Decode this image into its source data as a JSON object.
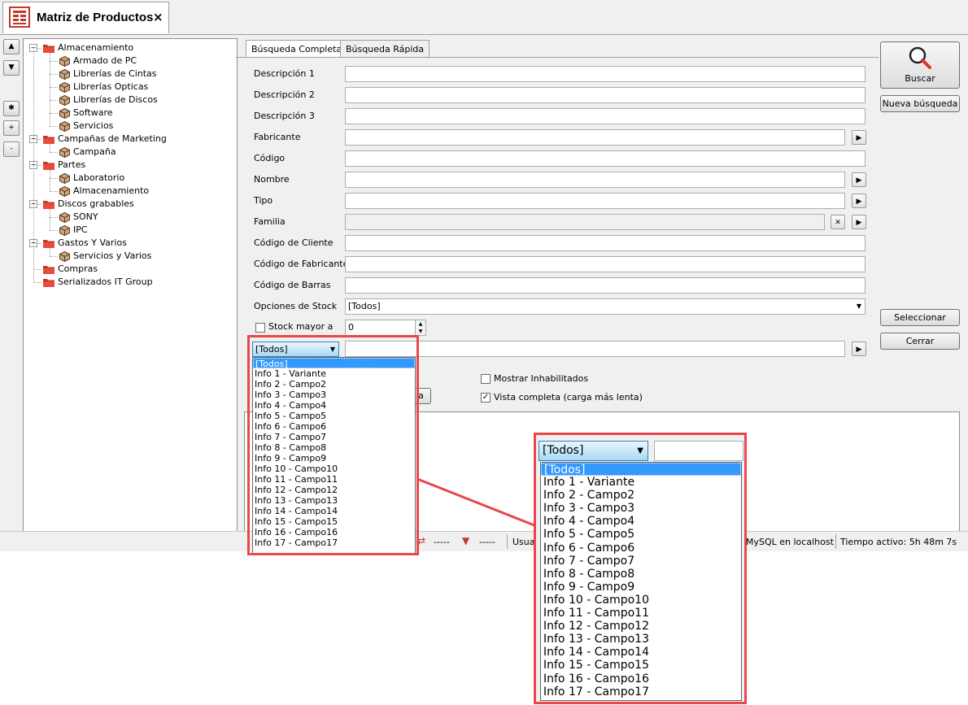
{
  "window": {
    "tab_title": "Matriz de Productos",
    "close_glyph": "×"
  },
  "sidebar_buttons": [
    "▲",
    "▼",
    "✱",
    "+",
    "-"
  ],
  "tree": [
    {
      "label": "Almacenamiento",
      "level": 0,
      "expanded": true
    },
    {
      "label": "Armado de PC",
      "level": 1
    },
    {
      "label": "Librerías de Cintas",
      "level": 1
    },
    {
      "label": "Librerías Opticas",
      "level": 1
    },
    {
      "label": "Librerías de Discos",
      "level": 1
    },
    {
      "label": "Software",
      "level": 1
    },
    {
      "label": "Servicios",
      "level": 1
    },
    {
      "label": "Campañas de Marketing",
      "level": 0,
      "expanded": true
    },
    {
      "label": "Campaña",
      "level": 1
    },
    {
      "label": "Partes",
      "level": 0,
      "expanded": true
    },
    {
      "label": "Laboratorio",
      "level": 1
    },
    {
      "label": "Almacenamiento",
      "level": 1
    },
    {
      "label": "Discos grabables",
      "level": 0,
      "expanded": true
    },
    {
      "label": "SONY",
      "level": 1
    },
    {
      "label": "IPC",
      "level": 1
    },
    {
      "label": "Gastos Y Varios",
      "level": 0,
      "expanded": true
    },
    {
      "label": "Servicios y Varios",
      "level": 1
    },
    {
      "label": "Compras",
      "level": 0
    },
    {
      "label": "Serializados IT Group",
      "level": 0
    }
  ],
  "search_tabs": [
    "Búsqueda Completa",
    "Búsqueda Rápida"
  ],
  "form": {
    "descripcion1": "Descripción 1",
    "descripcion2": "Descripción 2",
    "descripcion3": "Descripción 3",
    "fabricante": "Fabricante",
    "codigo": "Código",
    "nombre": "Nombre",
    "tipo": "Tipo",
    "familia": "Familia",
    "codigo_cliente": "Código de Cliente",
    "codigo_fabricante": "Código de Fabricante",
    "codigo_barras": "Código de Barras",
    "opciones_stock": "Opciones de Stock",
    "opciones_stock_value": "[Todos]",
    "stock_mayor": "Stock mayor a",
    "stock_mayor_value": "0",
    "info_combo_value": "[Todos]",
    "mostrar_inhabilitados": "Mostrar Inhabilitados",
    "vista_completa": "Vista completa (carga más lenta)",
    "partial_button_text": "a"
  },
  "buttons": {
    "buscar": "Buscar",
    "nueva_busqueda": "Nueva búsqueda",
    "seleccionar": "Seleccionar",
    "cerrar": "Cerrar"
  },
  "dropdown_items": [
    "[Todos]",
    "Info 1 - Variante",
    "Info 2 - Campo2",
    "Info 3 - Campo3",
    "Info 4 - Campo4",
    "Info 5 - Campo5",
    "Info 6 - Campo6",
    "Info 7 - Campo7",
    "Info 8 - Campo8",
    "Info 9 - Campo9",
    "Info 10 - Campo10",
    "Info 11 - Campo11",
    "Info 12 - Campo12",
    "Info 13 - Campo13",
    "Info 14 - Campo14",
    "Info 15 - Campo15",
    "Info 16 - Campo16",
    "Info 17 - Campo17"
  ],
  "statusbar": {
    "count1": "-----",
    "count2": "-----",
    "user": "Usua",
    "db": "MySQL en localhost",
    "uptime": "Tiempo activo: 5h 48m 7s"
  },
  "colors": {
    "highlight": "#e8474c",
    "selection": "#3399ff",
    "folder": "#c0392b"
  }
}
